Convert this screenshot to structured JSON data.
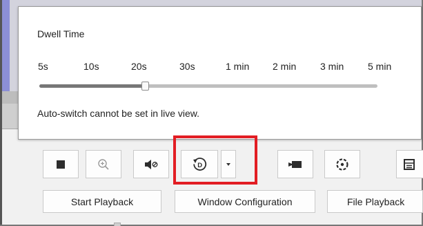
{
  "dwell_popup": {
    "title": "Dwell Time",
    "ticks": [
      "5s",
      "10s",
      "20s",
      "30s",
      "1 min",
      "2 min",
      "3 min",
      "5 min"
    ],
    "selected_value": "20s",
    "note": "Auto-switch cannot be set in live view."
  },
  "toolbar": {
    "buttons": [
      {
        "name": "stop-all-button",
        "icon": "stop-icon"
      },
      {
        "name": "zoom-button",
        "icon": "zoom-in-icon"
      },
      {
        "name": "mute-button",
        "icon": "mute-icon"
      },
      {
        "name": "dwell-time-button",
        "icon": "dwell-clock-icon"
      },
      {
        "name": "dwell-time-dropdown",
        "icon": "chevron-down-icon"
      },
      {
        "name": "camera-button",
        "icon": "camera-icon"
      },
      {
        "name": "ptz-button",
        "icon": "ptz-icon"
      },
      {
        "name": "layout-button",
        "icon": "layout-icon"
      }
    ],
    "highlight_color": "#e21d23"
  },
  "bottom_buttons": {
    "start_playback": "Start Playback",
    "window_configuration": "Window Configuration",
    "file_playback": "File Playback"
  }
}
